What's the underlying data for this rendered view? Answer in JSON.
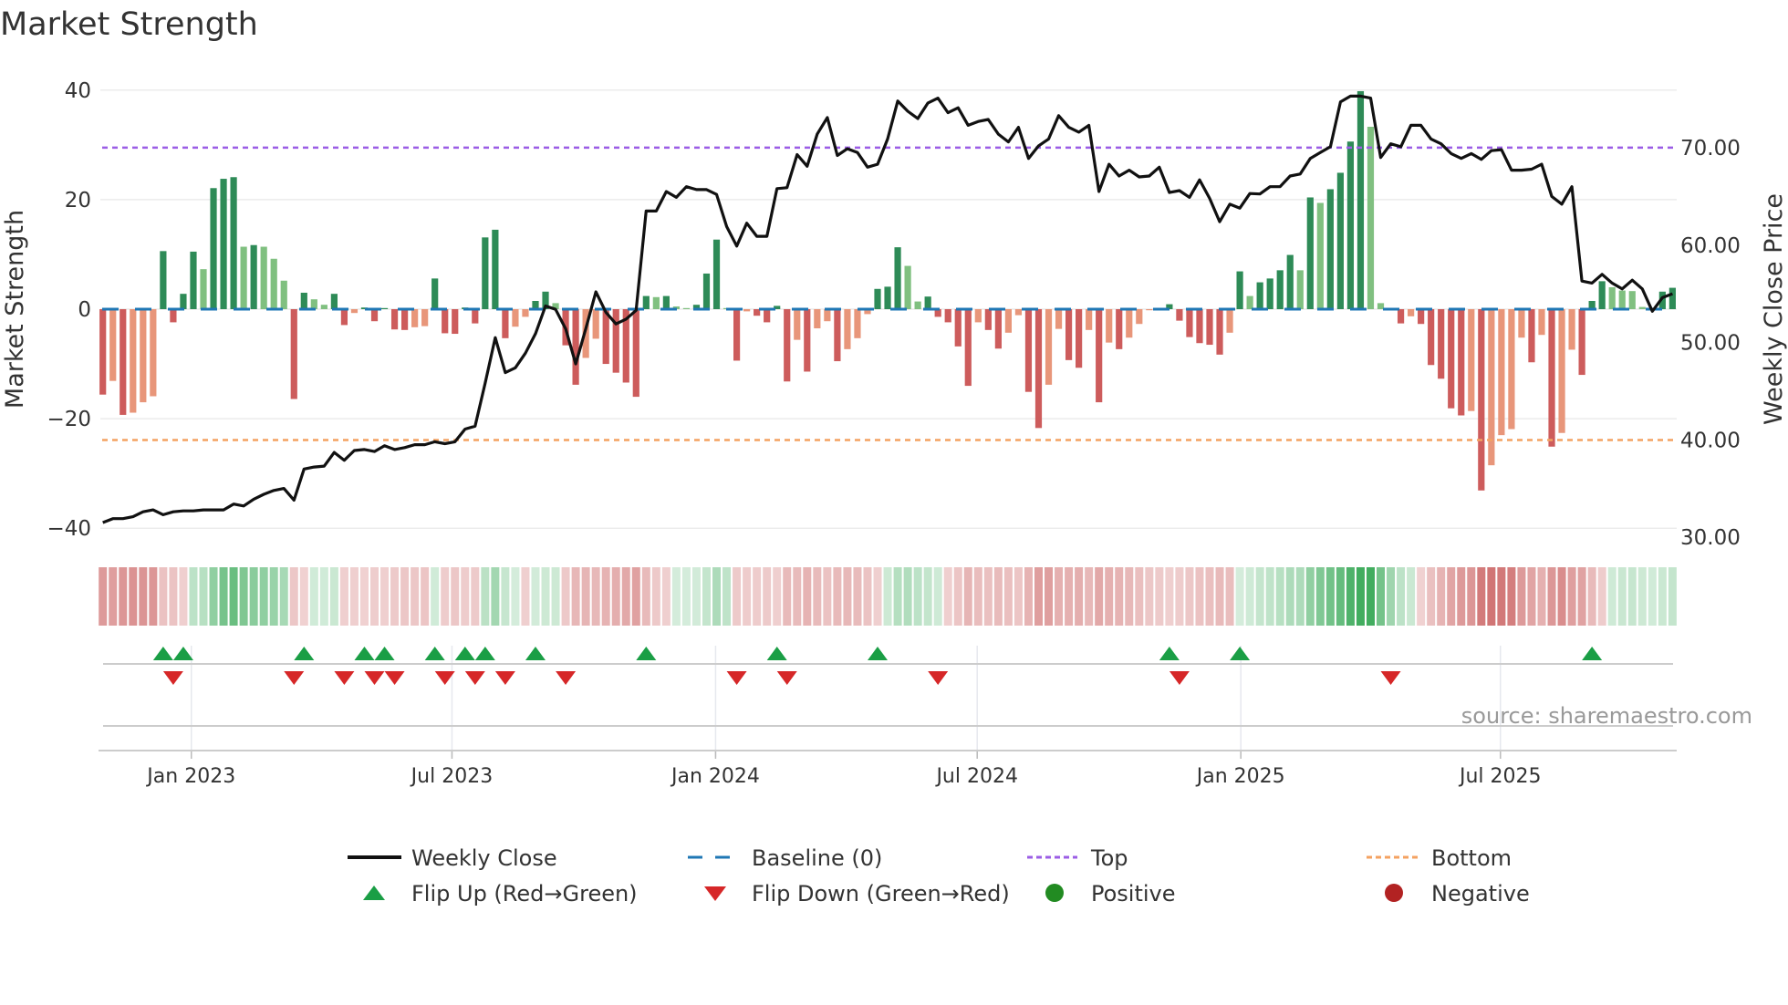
{
  "chart_data": {
    "type": "bar",
    "title": "Market Strength",
    "ylabel": "Market Strength",
    "y2label": "Weekly Close Price",
    "ylim": [
      -40,
      40
    ],
    "y2lim": [
      30,
      75
    ],
    "yticks": [
      {
        "v": 40,
        "label": "40"
      },
      {
        "v": 20,
        "label": "20"
      },
      {
        "v": 0,
        "label": "0"
      },
      {
        "v": -20,
        "label": "−20"
      },
      {
        "v": -40,
        "label": "−40"
      }
    ],
    "y2ticks": [
      {
        "v": 70,
        "label": "70.00"
      },
      {
        "v": 60,
        "label": "60.00"
      },
      {
        "v": 50,
        "label": "50.00"
      },
      {
        "v": 40,
        "label": "40.00"
      },
      {
        "v": 30,
        "label": "30.00"
      }
    ],
    "xticks": [
      {
        "week": 9.8,
        "label": "Jan 2023"
      },
      {
        "week": 35.7,
        "label": "Jul 2023"
      },
      {
        "week": 61.9,
        "label": "Jan 2024"
      },
      {
        "week": 87.9,
        "label": "Jul 2024"
      },
      {
        "week": 114.1,
        "label": "Jan 2025"
      },
      {
        "week": 139.9,
        "label": "Jul 2025"
      }
    ],
    "top_line": 29.5,
    "bottom_line": -23.9,
    "strength": [
      -15.6,
      -13.1,
      -19.3,
      -18.9,
      -17,
      -15.9,
      10.6,
      -2.4,
      2.8,
      10.5,
      7.3,
      22.1,
      23.8,
      24.1,
      11.4,
      11.7,
      11.4,
      9.2,
      5.2,
      -16.4,
      3,
      1.8,
      0.8,
      2.8,
      -2.9,
      -0.7,
      0.3,
      -2.2,
      0.2,
      -3.7,
      -3.8,
      -3.3,
      -3.1,
      5.6,
      -4.4,
      -4.5,
      0.3,
      -2.6,
      13.1,
      14.5,
      -5.3,
      -3.2,
      -1.4,
      1.5,
      3.2,
      1.1,
      -6.6,
      -13.8,
      -8.9,
      -5.4,
      -10,
      -11.6,
      -13.4,
      -16,
      2.4,
      2.2,
      2.4,
      0.5,
      0.2,
      0.8,
      6.5,
      12.7,
      0.2,
      -9.4,
      -0.4,
      -1.2,
      -2.4,
      0.6,
      -13.2,
      -5.6,
      -11.4,
      -3.5,
      -2.2,
      -9.5,
      -7.3,
      -5.3,
      -0.9,
      3.7,
      4.1,
      11.3,
      7.9,
      1.4,
      2.3,
      -1.4,
      -2.4,
      -6.8,
      -14,
      -2.4,
      -3.8,
      -7.2,
      -4.3,
      -1.1,
      -15.1,
      -21.7,
      -13.8,
      -3.6,
      -9.3,
      -10.7,
      -3.8,
      -17,
      -6.1,
      -7.3,
      -5.2,
      -2.7,
      -0.2,
      -0.2,
      0.9,
      -2.1,
      -5.1,
      -6.2,
      -6.5,
      -8.3,
      -4.3,
      6.9,
      2.4,
      4.9,
      5.6,
      7.1,
      9.9,
      7.1,
      20.4,
      19.4,
      21.9,
      24.9,
      30.6,
      39.8,
      33.3,
      1.1,
      -0.2,
      -2.6,
      -1.3,
      -2.7,
      -10.2,
      -12.7,
      -18.1,
      -19.4,
      -18.6,
      -33.1,
      -28.5,
      -23,
      -21.9,
      -5.2,
      -9.7,
      -4.7,
      -25.1,
      -22.6,
      -7.4,
      -12,
      1.5,
      5.1,
      4,
      3.4,
      3.3,
      0.4,
      0,
      3.2,
      3.9
    ],
    "weekly_close": [
      31.5,
      31.9,
      31.9,
      32.1,
      32.6,
      32.8,
      32.3,
      32.6,
      32.7,
      32.7,
      32.8,
      32.8,
      32.8,
      33.4,
      33.2,
      33.9,
      34.4,
      34.8,
      35.0,
      33.8,
      37.0,
      37.2,
      37.3,
      38.7,
      37.9,
      38.9,
      39.0,
      38.8,
      39.4,
      39.0,
      39.2,
      39.5,
      39.5,
      39.8,
      39.6,
      39.8,
      41.1,
      41.4,
      45.8,
      50.5,
      46.9,
      47.4,
      48.9,
      50.9,
      53.75,
      53.4,
      51.4,
      47.8,
      51.4,
      55.2,
      53.1,
      51.9,
      52.4,
      53.3,
      63.5,
      63.5,
      65.5,
      64.9,
      66.0,
      65.7,
      65.7,
      65.2,
      61.9,
      59.9,
      62.25,
      60.9,
      60.9,
      65.8,
      65.9,
      69.3,
      68.1,
      71.4,
      73.1,
      69.2,
      69.9,
      69.5,
      68.0,
      68.3,
      70.9,
      74.8,
      73.75,
      73.0,
      74.6,
      75.1,
      73.6,
      74.1,
      72.3,
      72.7,
      72.9,
      71.4,
      70.6,
      72.1,
      68.9,
      70.2,
      70.9,
      73.3,
      72.1,
      71.6,
      72.3,
      65.5,
      68.3,
      67.1,
      67.7,
      67.0,
      67.1,
      68.0,
      65.4,
      65.6,
      64.9,
      66.7,
      64.8,
      62.4,
      64.2,
      63.8,
      65.3,
      65.25,
      66.0,
      66.0,
      67.1,
      67.3,
      68.9,
      69.5,
      70.1,
      74.7,
      75.3,
      75.3,
      75.1,
      69.0,
      70.4,
      70.1,
      72.3,
      72.3,
      70.9,
      70.4,
      69.4,
      68.9,
      69.4,
      68.8,
      69.7,
      69.8,
      67.7,
      67.7,
      67.8,
      68.3,
      65.0,
      64.2,
      66.0,
      56.3,
      56.1,
      57.0,
      56.1,
      55.5,
      56.4,
      55.5,
      53.2,
      54.6,
      55.0
    ],
    "flip_up_weeks": [
      7,
      9,
      21,
      27,
      29,
      34,
      37,
      39,
      44,
      55,
      68,
      78,
      107,
      114,
      149
    ],
    "flip_down_weeks": [
      8,
      20,
      25,
      28,
      30,
      35,
      38,
      41,
      47,
      64,
      69,
      84,
      108,
      129
    ],
    "legend": {
      "weekly_close": "Weekly Close",
      "baseline": "Baseline (0)",
      "top": "Top",
      "bottom": "Bottom",
      "flip_up": "Flip Up (Red→Green)",
      "flip_down": "Flip Down (Green→Red)",
      "positive": "Positive",
      "negative": "Negative"
    },
    "legend_placement": "bottom",
    "source": "source: sharemaestro.com",
    "colors": {
      "pos_strong": "#2e8b57",
      "pos_weak": "#80c080",
      "neg_strong": "#cd5c5c",
      "neg_weak": "#e8967a",
      "baseline": "#1f77b4",
      "top": "#9b5de5",
      "bottom": "#f4a261",
      "flip_up": "#1a9e45",
      "flip_down": "#d62728",
      "positive": "#228b22",
      "negative": "#b22222",
      "line": "#111111"
    }
  }
}
